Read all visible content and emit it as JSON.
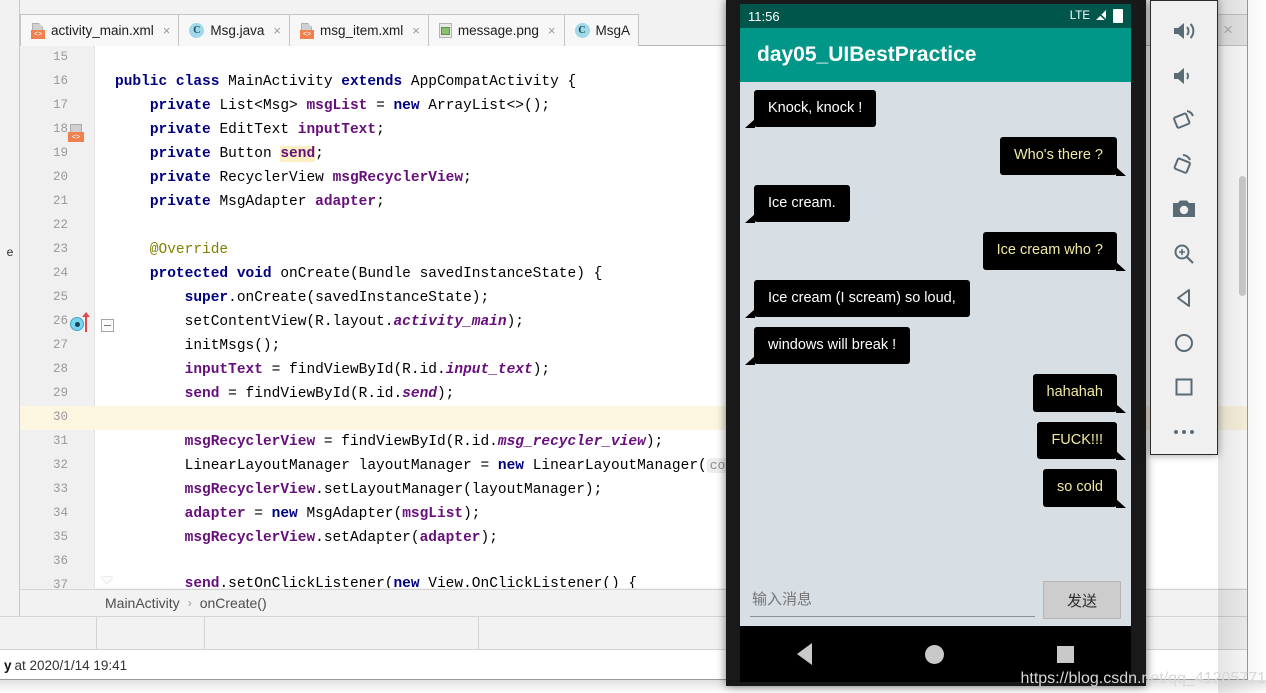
{
  "ide": {
    "close_label": "×",
    "tabs": [
      {
        "label": "activity_main.xml",
        "icon": "xml-file-icon",
        "close": "×"
      },
      {
        "label": "Msg.java",
        "icon": "java-class-icon",
        "close": "×"
      },
      {
        "label": "msg_item.xml",
        "icon": "xml-file-icon",
        "close": "×"
      },
      {
        "label": "message.png",
        "icon": "image-file-icon",
        "close": "×"
      },
      {
        "label": "MsgA",
        "icon": "java-class-icon",
        "close": ""
      }
    ],
    "left_tool_tab": "e",
    "gutter_numbers": [
      "15",
      "16",
      "17",
      "18",
      "19",
      "20",
      "21",
      "22",
      "23",
      "24",
      "25",
      "26",
      "27",
      "28",
      "29",
      "30",
      "31",
      "32",
      "33",
      "34",
      "35",
      "36",
      "37"
    ],
    "breadcrumb": {
      "class": "MainActivity",
      "separator": "›",
      "method": "onCreate()"
    },
    "statusbar": {
      "lead": "y",
      "text": "at 2020/1/14 19:41"
    },
    "code_lines": [
      {
        "num": "15",
        "text": ""
      },
      {
        "num": "16",
        "text": "public class MainActivity extends AppCompatActivity {"
      },
      {
        "num": "17",
        "text": "    private List<Msg> msgList = new ArrayList<>();"
      },
      {
        "num": "18",
        "text": "    private EditText inputText;"
      },
      {
        "num": "19",
        "text": "    private Button send;"
      },
      {
        "num": "20",
        "text": "    private RecyclerView msgRecyclerView;"
      },
      {
        "num": "21",
        "text": "    private MsgAdapter adapter;"
      },
      {
        "num": "22",
        "text": ""
      },
      {
        "num": "23",
        "text": "    @Override"
      },
      {
        "num": "24",
        "text": "    protected void onCreate(Bundle savedInstanceState) {"
      },
      {
        "num": "25",
        "text": "        super.onCreate(savedInstanceState);"
      },
      {
        "num": "26",
        "text": "        setContentView(R.layout.activity_main);"
      },
      {
        "num": "27",
        "text": "        initMsgs();"
      },
      {
        "num": "28",
        "text": "        inputText = findViewById(R.id.input_text);"
      },
      {
        "num": "29",
        "text": "        send = findViewById(R.id.send);"
      },
      {
        "num": "30",
        "text": ""
      },
      {
        "num": "31",
        "text": "        msgRecyclerView = findViewById(R.id.msg_recycler_view);"
      },
      {
        "num": "32",
        "text": "        LinearLayoutManager layoutManager = new LinearLayoutManager( context: t"
      },
      {
        "num": "33",
        "text": "        msgRecyclerView.setLayoutManager(layoutManager);"
      },
      {
        "num": "34",
        "text": "        adapter = new MsgAdapter(msgList);"
      },
      {
        "num": "35",
        "text": "        msgRecyclerView.setAdapter(adapter);"
      },
      {
        "num": "36",
        "text": ""
      },
      {
        "num": "37",
        "text": "        send.setOnClickListener(new View.OnClickListener() {"
      }
    ],
    "parameter_hint": "context:",
    "highlighted_token": "send",
    "current_line": "30"
  },
  "emulator": {
    "status": {
      "time": "11:56",
      "network": "LTE",
      "battery_icon": "battery-icon"
    },
    "app_title": "day05_UIBestPractice",
    "messages": [
      {
        "side": "left",
        "text": "Knock, knock !"
      },
      {
        "side": "right",
        "text": "Who's there ?"
      },
      {
        "side": "left",
        "text": "Ice cream."
      },
      {
        "side": "right",
        "text": "Ice cream who ?"
      },
      {
        "side": "left",
        "text": "Ice cream (I scream) so loud,"
      },
      {
        "side": "left",
        "text": "windows will break !"
      },
      {
        "side": "right",
        "text": "hahahah"
      },
      {
        "side": "right",
        "text": "FUCK!!!"
      },
      {
        "side": "right",
        "text": "so cold"
      }
    ],
    "input_placeholder": "输入消息",
    "send_label": "发送",
    "nav": {
      "back": "back-nav",
      "home": "home-nav",
      "recent": "recent-nav"
    },
    "watermark": "https://blog.csdn.net/qq_41205771",
    "colors": {
      "appbar": "#009688",
      "statusbar": "#00564b",
      "chat_bg": "#d7dee4",
      "bubble_bg": "#000000",
      "bubble_left_text": "#ffffff",
      "bubble_right_text": "#f0eaa0"
    }
  },
  "emulator_toolbar": {
    "buttons": [
      {
        "name": "volume-up-icon",
        "label": "Volume Up"
      },
      {
        "name": "volume-down-icon",
        "label": "Volume Down"
      },
      {
        "name": "rotate-left-icon",
        "label": "Rotate Left"
      },
      {
        "name": "rotate-right-icon",
        "label": "Rotate Right"
      },
      {
        "name": "camera-icon",
        "label": "Take Screenshot"
      },
      {
        "name": "zoom-in-icon",
        "label": "Zoom"
      },
      {
        "name": "back-icon",
        "label": "Back"
      },
      {
        "name": "home-icon",
        "label": "Home"
      },
      {
        "name": "overview-icon",
        "label": "Overview"
      },
      {
        "name": "more-icon",
        "label": "More"
      }
    ]
  }
}
